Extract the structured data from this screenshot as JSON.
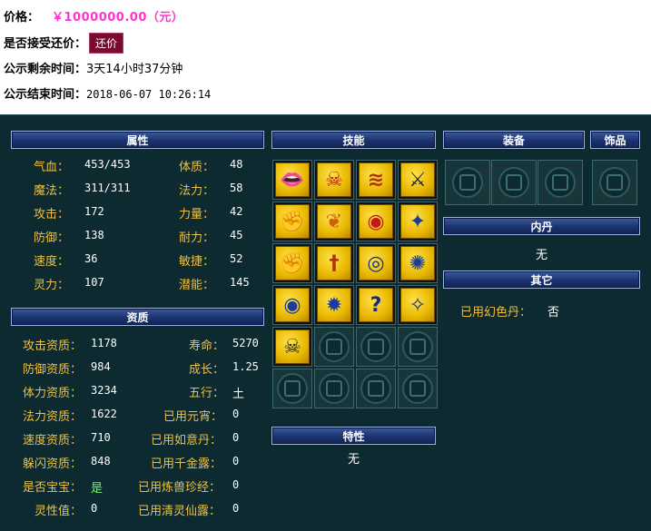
{
  "listing": {
    "price_label": "价格：",
    "price_value": "￥1000000.00（元）",
    "counter_offer_label": "是否接受还价：",
    "counter_offer_button": "还价",
    "remaining_label": "公示剩余时间：",
    "remaining_value": "3天14小时37分钟",
    "end_label": "公示结束时间：",
    "end_value": "2018-06-07 10:26:14"
  },
  "headers": {
    "attributes": "属性",
    "aptitude": "资质",
    "skills": "技能",
    "traits": "特性",
    "equipment": "装备",
    "ornament": "饰品",
    "inner_pill": "内丹",
    "other": "其它"
  },
  "attributes": {
    "left": [
      {
        "label": "气血：",
        "value": "453/453"
      },
      {
        "label": "魔法：",
        "value": "311/311"
      },
      {
        "label": "攻击：",
        "value": "172"
      },
      {
        "label": "防御：",
        "value": "138"
      },
      {
        "label": "速度：",
        "value": "36"
      },
      {
        "label": "灵力：",
        "value": "107"
      }
    ],
    "right": [
      {
        "label": "体质：",
        "value": "48"
      },
      {
        "label": "法力：",
        "value": "58"
      },
      {
        "label": "力量：",
        "value": "42"
      },
      {
        "label": "耐力：",
        "value": "45"
      },
      {
        "label": "敏捷：",
        "value": "52"
      },
      {
        "label": "潜能：",
        "value": "145"
      }
    ]
  },
  "aptitude": {
    "left": [
      {
        "label": "攻击资质：",
        "value": "1178"
      },
      {
        "label": "防御资质：",
        "value": "984"
      },
      {
        "label": "体力资质：",
        "value": "3234"
      },
      {
        "label": "法力资质：",
        "value": "1622"
      },
      {
        "label": "速度资质：",
        "value": "710"
      },
      {
        "label": "躲闪资质：",
        "value": "848"
      },
      {
        "label": "是否宝宝：",
        "value": "是"
      },
      {
        "label": "灵性值：",
        "value": "0"
      }
    ],
    "right": [
      {
        "label": "寿命：",
        "value": "5270"
      },
      {
        "label": "成长：",
        "value": "1.25"
      },
      {
        "label": "五行：",
        "value": "土"
      },
      {
        "label": "已用元宵：",
        "value": "0"
      },
      {
        "label": "已用如意丹：",
        "value": "0"
      },
      {
        "label": "已用千金露：",
        "value": "0"
      },
      {
        "label": "已用炼兽珍经：",
        "value": "0"
      },
      {
        "label": "已用清灵仙露：",
        "value": "0"
      }
    ]
  },
  "skills": {
    "icons": [
      "mouth-bite-icon",
      "skull-flame-icon",
      "claw-slash-icon",
      "crossed-swords-icon",
      "arm-strength-icon",
      "wings-icon",
      "eye-fire-icon",
      "blue-bird-icon",
      "flex-arm-icon",
      "sword-icon",
      "owl-icon",
      "sun-gear-icon",
      "eye-swirl-icon",
      "sun-burst-icon",
      "brain-question-icon",
      "falling-stars-icon",
      "skeleton-icon"
    ],
    "empty_slots": 7
  },
  "traits": {
    "value": "无"
  },
  "inner_pill": {
    "value": "无"
  },
  "other": {
    "label": "已用幻色丹：",
    "value": "否"
  },
  "equipment": {
    "slots": 3
  },
  "ornament": {
    "slots": 1
  },
  "colors": {
    "panel_bg": "#0c2a30",
    "header_bg": "#1c3270",
    "label_gold": "#f0c040",
    "price_pink": "#ff33cc",
    "yes_green": "#66ff66",
    "button_bg": "#7a0b2e"
  }
}
